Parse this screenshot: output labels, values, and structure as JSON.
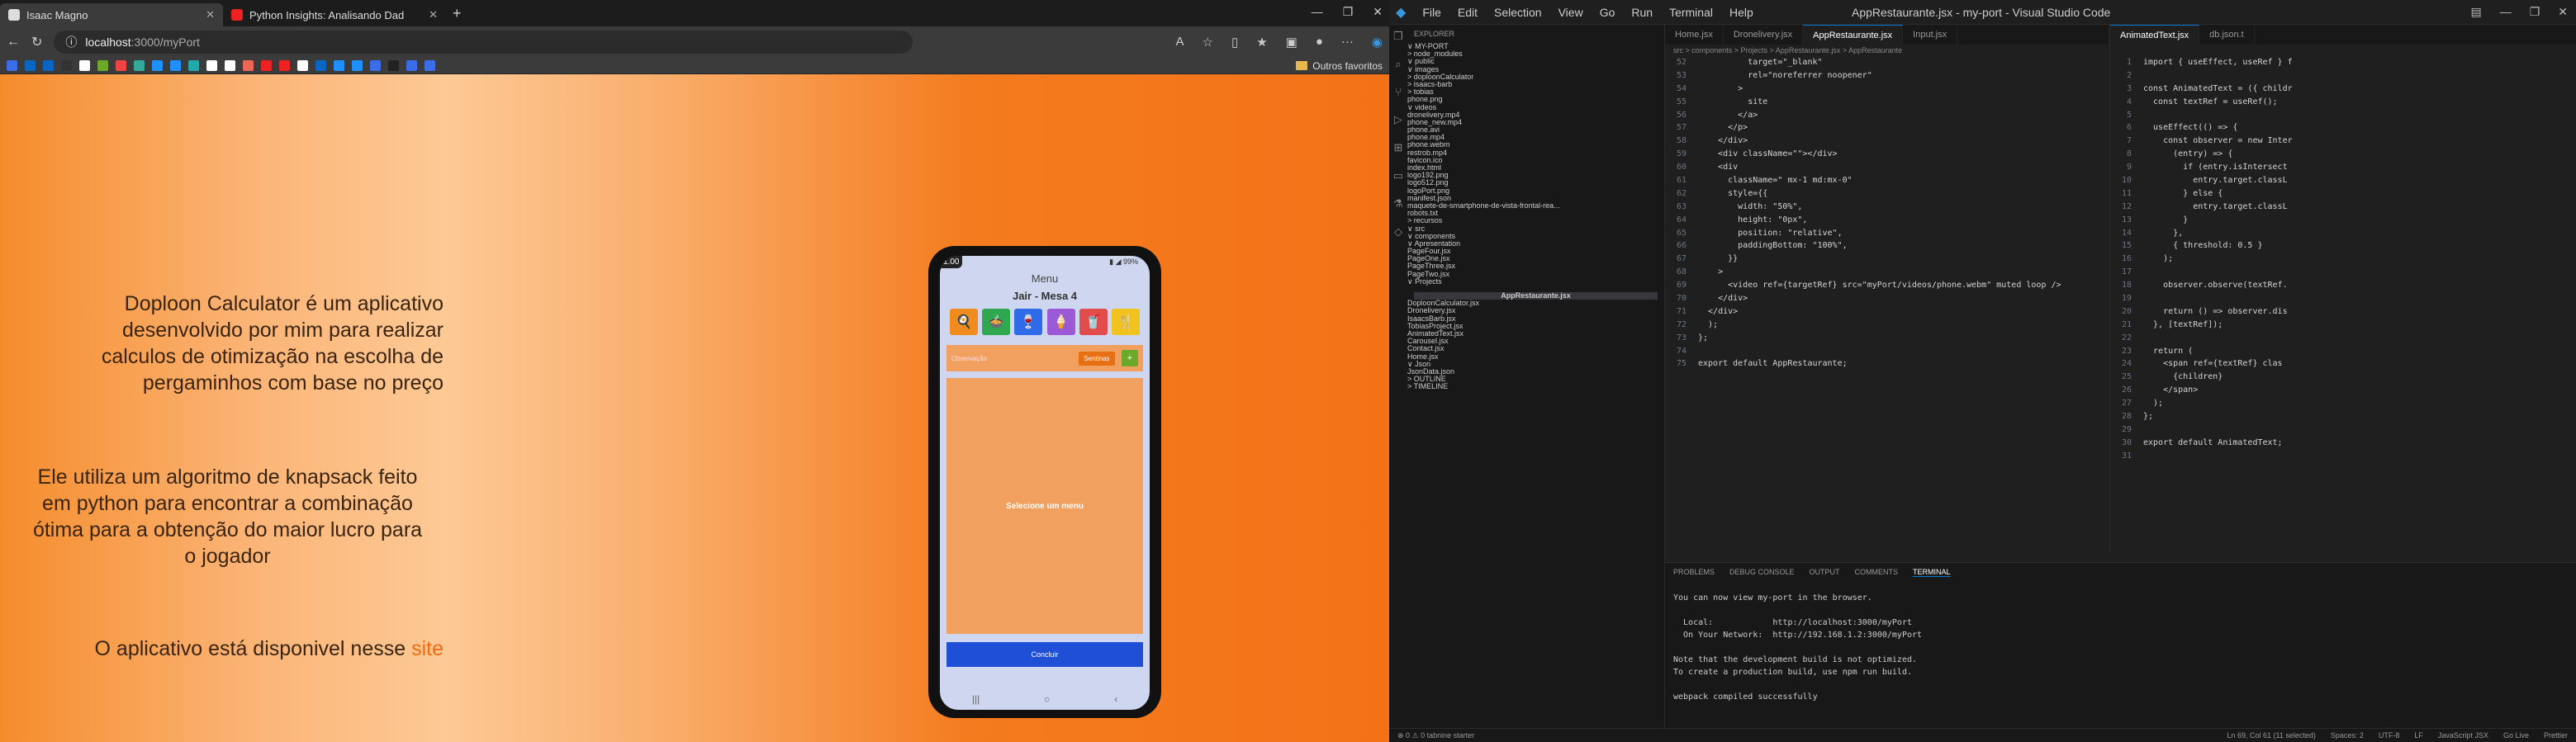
{
  "browser": {
    "tabs": [
      {
        "label": "Isaac Magno",
        "active": true
      },
      {
        "label": "Python Insights: Analisando Dad",
        "active": false
      }
    ],
    "url_host": "localhost",
    "url_path": ":3000/myPort",
    "bookmarks_folder": "Outros favoritos",
    "bookmark_colors": [
      "#3a6ee8",
      "#0a66c2",
      "#0a66c2",
      "#333",
      "#fff",
      "#6aa92a",
      "#e44",
      "#3a9",
      "#1e90ff",
      "#1e90ff",
      "#2aa",
      "#fff",
      "#fff",
      "#e65",
      "#e22",
      "#e22",
      "#fff",
      "#0a66c2",
      "#1e90ff",
      "#1e90ff",
      "#3a6ee8",
      "#222",
      "#3a6ee8",
      "#3a6ee8"
    ]
  },
  "page": {
    "p1": [
      "Doploon Calculator é um aplicativo",
      "desenvolvido por mim para realizar",
      "calculos de otimização na escolha de",
      "pergaminhos com base no preço"
    ],
    "p2": [
      "Ele utiliza um algoritmo de knapsack feito",
      "em python para encontrar a combinação",
      "ótima para a obtenção do maior lucro para",
      "o jogador"
    ],
    "p3_prefix": "O aplicativo está disponivel nesse",
    "p3_link": "site"
  },
  "phone": {
    "zoom": "1.00",
    "menu_title": "Menu",
    "table_title": "Jair - Mesa 4",
    "categories": [
      {
        "icon": "🍳",
        "color": "#f08c1e"
      },
      {
        "icon": "🍲",
        "color": "#2fa84f"
      },
      {
        "icon": "🍷",
        "color": "#2f6be8"
      },
      {
        "icon": "🍦",
        "color": "#9b59d6"
      },
      {
        "icon": "🥤",
        "color": "#e24c4c"
      },
      {
        "icon": "🍴",
        "color": "#f2c21e"
      }
    ],
    "obs_placeholder": "Observação",
    "obs_button": "Sentinas",
    "add_button": "+",
    "select_text": "Selecione um menu",
    "conclude": "Concluir"
  },
  "vscode": {
    "title": "AppRestaurante.jsx - my-port - Visual Studio Code",
    "menu": [
      "File",
      "Edit",
      "Selection",
      "View",
      "Go",
      "Run",
      "Terminal",
      "Help"
    ],
    "explorer_title": "EXPLORER",
    "tree": [
      "∨ MY-PORT",
      "  > node_modules",
      "  ∨ public",
      "    ∨ images",
      "      > doploonCalculator",
      "      > isaacs-barb",
      "      > tobias",
      "        phone.png",
      "    ∨ videos",
      "        dronelivery.mp4",
      "        phone_new.mp4",
      "        phone.avi",
      "        phone.mp4",
      "        phone.webm",
      "        restrob.mp4",
      "      favicon.ico",
      "      index.html",
      "      logo192.png",
      "      logo512.png",
      "      logoPort.png",
      "      manifest.json",
      "      maquete-de-smartphone-de-vista-frontal-rea...",
      "      robots.txt",
      "  > recursos",
      "  ∨ src",
      "    ∨ components",
      "      ∨ Apresentation",
      "          PageFour.jsx",
      "          PageOne.jsx",
      "          PageThree.jsx",
      "          PageTwo.jsx",
      "      ∨ Projects",
      "          AppRestaurante.jsx",
      "          DoploonCalculator.jsx",
      "          Dronelivery.jsx",
      "          IsaacsBarb.jsx",
      "          TobiasProject.jsx",
      "        AnimatedText.jsx",
      "        Carousel.jsx",
      "        Contact.jsx",
      "        Home.jsx",
      "    ∨ Json",
      "        JsonData.json",
      "> OUTLINE",
      "> TIMELINE"
    ],
    "editor_tabs": [
      "Home.jsx",
      "Dronelivery.jsx",
      "AppRestaurante.jsx",
      "Input.jsx"
    ],
    "breadcrumb": "src > components > Projects > AppRestaurante.jsx > AppRestaurante",
    "code_start": 52,
    "code": [
      "          target=\"_blank\"",
      "          rel=\"noreferrer noopener\"",
      "        >",
      "          site",
      "        </a>",
      "      </p>",
      "    </div>",
      "    <div className=\"\"></div>",
      "    <div",
      "      className=\" mx-1 md:mx-0\"",
      "      style={{",
      "        width: \"50%\",",
      "        height: \"0px\",",
      "        position: \"relative\",",
      "        paddingBottom: \"100%\",",
      "      }}",
      "    >",
      "      <video ref={targetRef} src=\"myPort/videos/phone.webm\" muted loop />",
      "    </div>",
      "  </div>",
      "  );",
      "};",
      "",
      "export default AppRestaurante;"
    ],
    "editor2_tabs": [
      "AnimatedText.jsx",
      "db.json.t"
    ],
    "code2_start": 1,
    "code2": [
      "import { useEffect, useRef } f",
      "",
      "const AnimatedText = ({ childr",
      "  const textRef = useRef();",
      "",
      "  useEffect(() => {",
      "    const observer = new Inter",
      "      (entry) => {",
      "        if (entry.isIntersect",
      "          entry.target.classL",
      "        } else {",
      "          entry.target.classL",
      "        }",
      "      },",
      "      { threshold: 0.5 }",
      "    );",
      "",
      "    observer.observe(textRef.",
      "",
      "    return () => observer.dis",
      "  }, [textRef]);",
      "",
      "  return (",
      "    <span ref={textRef} clas",
      "      {children}",
      "    </span>",
      "  );",
      "};",
      "",
      "export default AnimatedText;",
      ""
    ],
    "panel_tabs": [
      "PROBLEMS",
      "DEBUG CONSOLE",
      "OUTPUT",
      "COMMENTS",
      "TERMINAL"
    ],
    "terminal": [
      "You can now view my-port in the browser.",
      "",
      "  Local:            http://localhost:3000/myPort",
      "  On Your Network:  http://192.168.1.2:3000/myPort",
      "",
      "Note that the development build is not optimized.",
      "To create a production build, use npm run build.",
      "",
      "webpack compiled successfully"
    ],
    "status_left": "⊗ 0 ⚠ 0   tabnine starter",
    "status_right": [
      "Ln 69, Col 61 (11 selected)",
      "Spaces: 2",
      "UTF-8",
      "LF",
      "JavaScript JSX",
      "Go Live",
      "Prettier"
    ]
  }
}
